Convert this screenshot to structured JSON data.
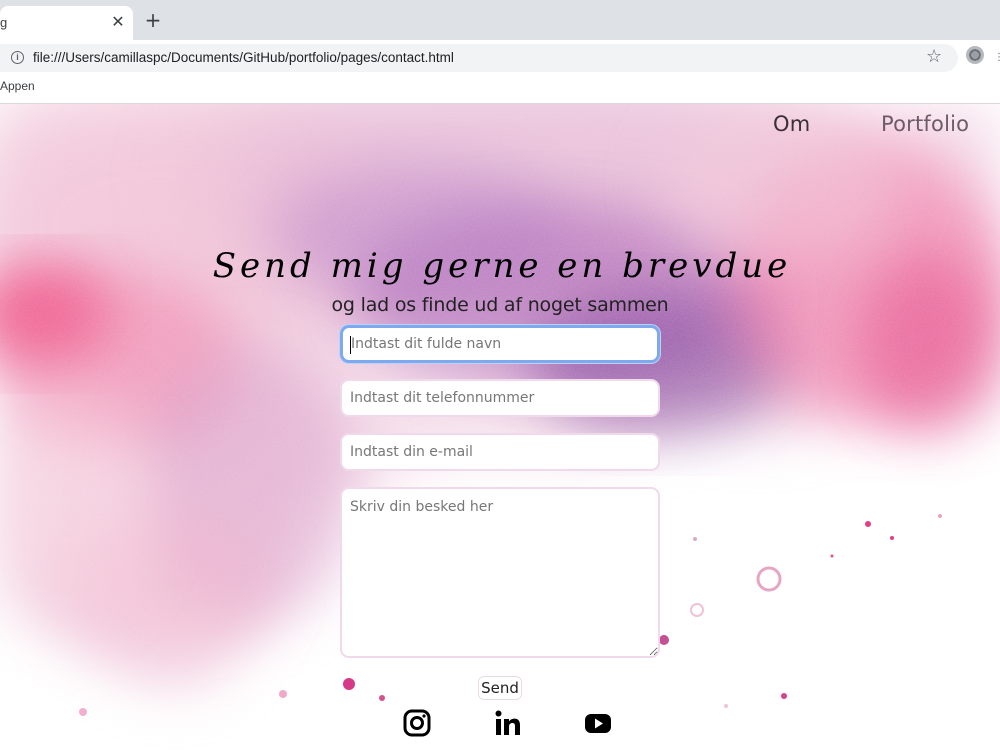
{
  "browser": {
    "tab_title": "g",
    "close_glyph": "✕",
    "new_tab_glyph": "+",
    "url": "file:///Users/camillaspc/Documents/GitHub/portfolio/pages/contact.html",
    "info_glyph": "i",
    "star_glyph": "☆",
    "bookmark_apps": "Appen",
    "icons": [
      "info-icon",
      "star-icon",
      "extension-icon"
    ]
  },
  "nav": {
    "om": "Om",
    "portfolio": "Portfolio"
  },
  "hero": {
    "title": "Send mig gerne en brevdue",
    "subtitle": "og lad os finde ud af noget sammen"
  },
  "form": {
    "name_placeholder": "Indtast dit fulde navn",
    "phone_placeholder": "Indtast dit telefonnummer",
    "email_placeholder": "Indtast din e-mail",
    "message_placeholder": "Skriv din besked her",
    "send_label": "Send"
  },
  "social": [
    "instagram-icon",
    "linkedin-icon",
    "youtube-icon"
  ],
  "colors": {
    "focus_border": "#7fa9ee",
    "field_border": "#f1d9ec",
    "pink": "#e8457a",
    "purple": "#7a3d99"
  }
}
